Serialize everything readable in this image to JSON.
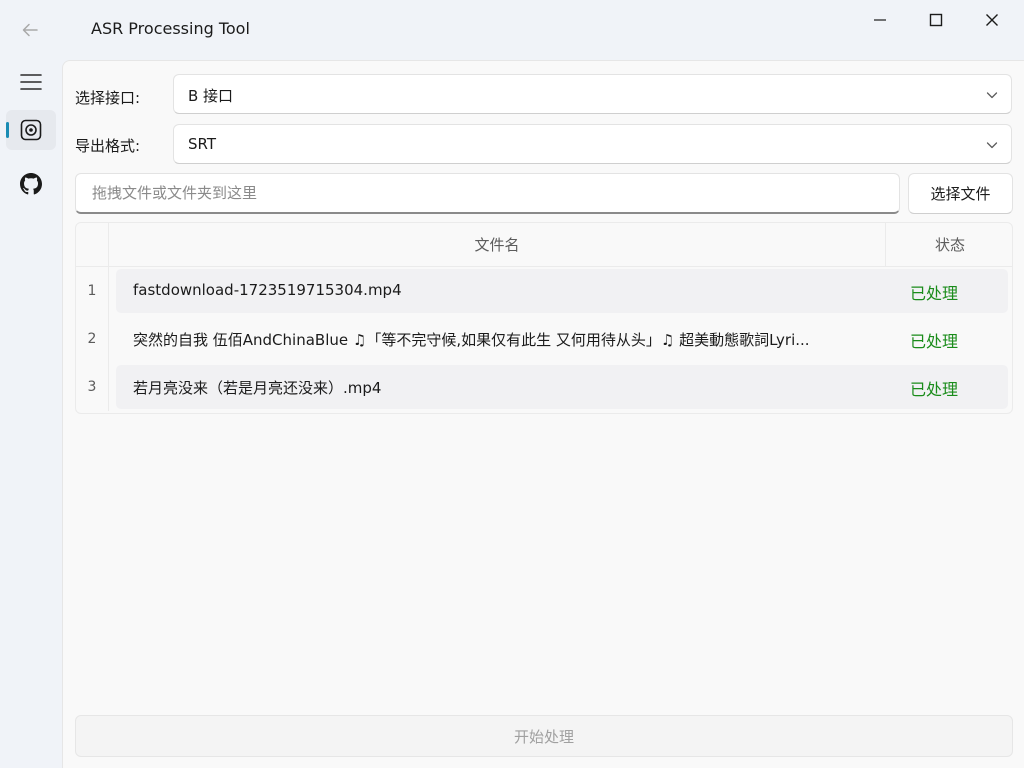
{
  "window": {
    "title": "ASR Processing Tool"
  },
  "form": {
    "api_label": "选择接口:",
    "api_value": "B 接口",
    "format_label": "导出格式:",
    "format_value": "SRT",
    "drop_placeholder": "拖拽文件或文件夹到这里",
    "select_file_label": "选择文件"
  },
  "table": {
    "columns": [
      "文件名",
      "状态"
    ],
    "rows": [
      {
        "index": "1",
        "name": "fastdownload-1723519715304.mp4",
        "status": "已处理"
      },
      {
        "index": "2",
        "name": "突然的自我 伍佰AndChinaBlue ♫「等不完守候,如果仅有此生 又何用待从头」♫ 超美動態歌詞Lyri...",
        "status": "已处理"
      },
      {
        "index": "3",
        "name": "若月亮没来（若是月亮还没来）.mp4",
        "status": "已处理"
      }
    ]
  },
  "actions": {
    "start_label": "开始处理"
  },
  "icons": {
    "back": "arrow-left-icon",
    "menu": "hamburger-menu-icon",
    "asr": "target-icon",
    "github": "github-icon",
    "minimize": "minimize-icon",
    "maximize": "maximize-icon",
    "close": "close-icon",
    "chevron": "chevron-down-icon"
  },
  "colors": {
    "accent": "#1a8cb4",
    "status_done": "#1a8c1a"
  }
}
